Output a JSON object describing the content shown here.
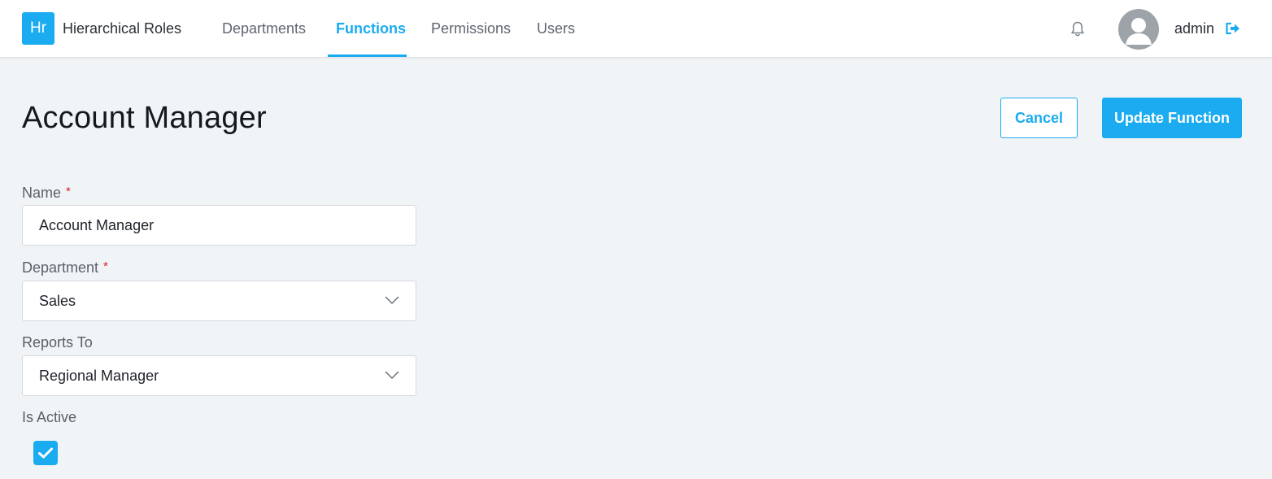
{
  "app": {
    "logo_text": "Hr",
    "title": "Hierarchical Roles"
  },
  "nav": {
    "items": [
      {
        "label": "Departments"
      },
      {
        "label": "Functions",
        "active": true
      },
      {
        "label": "Permissions"
      },
      {
        "label": "Users"
      }
    ]
  },
  "header": {
    "username": "admin",
    "icons": [
      "bell-icon",
      "avatar",
      "logout-icon"
    ]
  },
  "page": {
    "title": "Account Manager"
  },
  "actions": {
    "cancel_label": "Cancel",
    "update_label": "Update Function"
  },
  "form": {
    "name": {
      "label": "Name",
      "required_mark": "*",
      "value": "Account Manager"
    },
    "department": {
      "label": "Department",
      "required_mark": "*",
      "value": "Sales"
    },
    "reports_to": {
      "label": "Reports To",
      "value": "Regional Manager"
    },
    "is_active": {
      "label": "Is Active",
      "checked": true
    }
  },
  "colors": {
    "accent": "#1aabf0",
    "background": "#f1f4f7",
    "required": "#d8232a"
  }
}
